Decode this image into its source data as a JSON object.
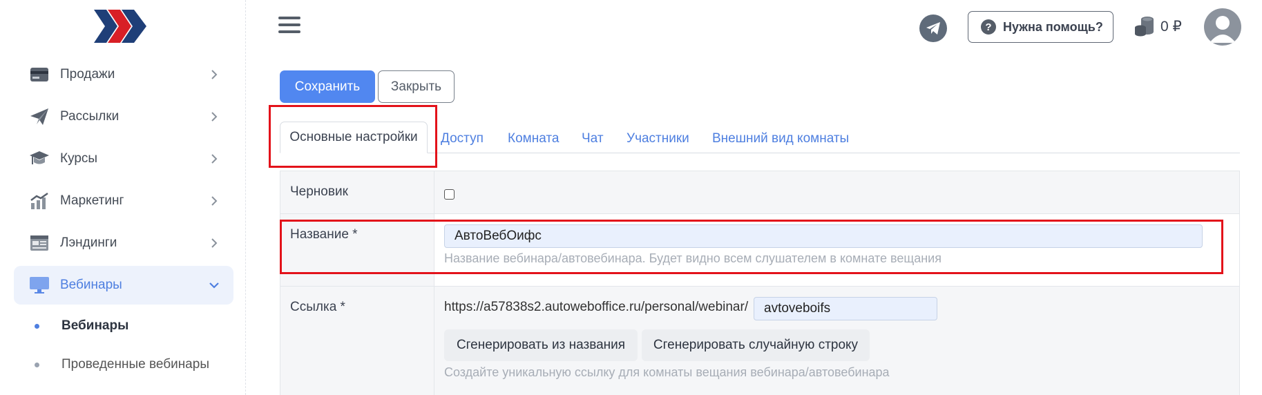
{
  "colors": {
    "accent": "#5187f0",
    "link": "#4e7fe0",
    "annotation": "#e3121a",
    "logo_red": "#d81f26",
    "logo_navy": "#1f3f78"
  },
  "sidebar": {
    "items": [
      {
        "label": "Продажи",
        "icon": "credit-card-icon"
      },
      {
        "label": "Рассылки",
        "icon": "paper-plane-icon"
      },
      {
        "label": "Курсы",
        "icon": "graduation-cap-icon"
      },
      {
        "label": "Маркетинг",
        "icon": "growth-chart-icon"
      },
      {
        "label": "Лэндинги",
        "icon": "landing-page-icon"
      },
      {
        "label": "Вебинары",
        "icon": "monitor-icon",
        "active": true
      }
    ],
    "subitems": [
      {
        "label": "Вебинары",
        "active": true
      },
      {
        "label": "Проведенные вебинары",
        "active": false
      }
    ]
  },
  "header": {
    "help_label": "Нужна помощь?",
    "balance": "0 ₽"
  },
  "toolbar": {
    "save_label": "Сохранить",
    "close_label": "Закрыть"
  },
  "tabs": [
    {
      "label": "Основные настройки",
      "active": true
    },
    {
      "label": "Доступ"
    },
    {
      "label": "Комната"
    },
    {
      "label": "Чат"
    },
    {
      "label": "Участники"
    },
    {
      "label": "Внешний вид комнаты"
    }
  ],
  "form": {
    "draft_label": "Черновик",
    "draft_checked": false,
    "name_label": "Название *",
    "name_value": "АвтоВебОифс",
    "name_hint": "Название вебинара/автовебинара. Будет видно всем слушателем в комнате вещания",
    "link_label": "Ссылка *",
    "link_prefix": "https://a57838s2.autoweboffice.ru/personal/webinar/",
    "link_value": "avtoveboifs",
    "gen_from_name": "Сгенерировать из названия",
    "gen_random": "Сгенерировать случайную строку",
    "link_hint": "Создайте уникальную ссылку для комнаты вещания вебинара/автовебинара"
  }
}
